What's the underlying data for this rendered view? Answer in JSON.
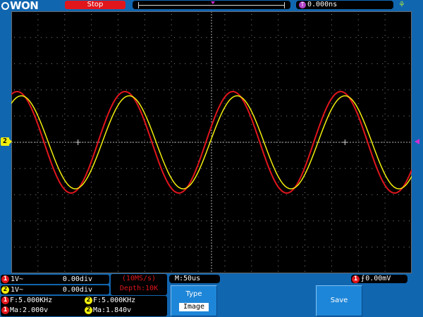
{
  "brand": {
    "logo_text": "WON"
  },
  "top_bar": {
    "run_status": "Stop",
    "trigger_time": "0.000ns",
    "trigger_badge": "T"
  },
  "waveform": {
    "ch2_marker": "2",
    "colors": {
      "ch1": "#e0161c",
      "ch2": "#f2ee0c",
      "grid": "#8c8c8c",
      "trigger": "#d22cd2"
    }
  },
  "channels": [
    {
      "badge": "1",
      "coupling": "1V~",
      "offset": "0.00div"
    },
    {
      "badge": "2",
      "coupling": "1V~",
      "offset": "0.00div"
    }
  ],
  "acquisition": {
    "sample_rate": "(10MS/s)",
    "depth": "Depth:10K"
  },
  "timebase": "M:50us",
  "trigger": {
    "badge": "1",
    "level": "0.00mV"
  },
  "measurements": {
    "ch1_freq": "F:5.000KHz",
    "ch2_freq": "F:5.000KHz",
    "ch1_amp": "Ma:2.000v",
    "ch2_amp": "Ma:1.840v"
  },
  "menu": {
    "type_label": "Type",
    "type_value": "Image",
    "save_label": "Save"
  }
}
